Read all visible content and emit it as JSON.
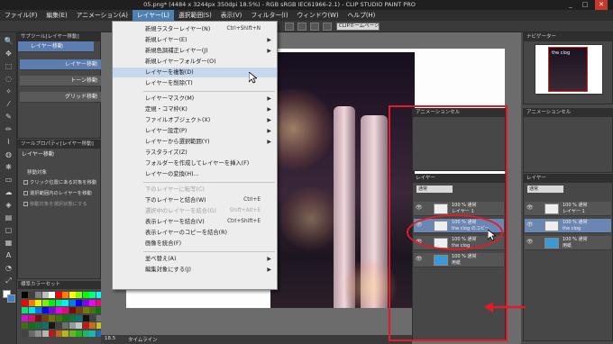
{
  "window": {
    "title": "05.png* (4484 x 3244px 350dpi 18.5%) - RGB sRGB IEC61966-2.1) - CLIP STUDIO PAINT PRO",
    "minimize": "_",
    "maximize": "□",
    "close": "✕"
  },
  "menubar": [
    {
      "label": "ファイル(F)"
    },
    {
      "label": "編集(E)"
    },
    {
      "label": "アニメーション(A)"
    },
    {
      "label": "レイヤー(L)",
      "active": true
    },
    {
      "label": "選択範囲(S)"
    },
    {
      "label": "表示(V)"
    },
    {
      "label": "フィルター(I)"
    },
    {
      "label": "ウィンドウ(W)"
    },
    {
      "label": "ヘルプ(H)"
    }
  ],
  "toolbar": {
    "homepage_button": "CLIPホームページ"
  },
  "left_panel": {
    "subtool_tab": "サブツール[レイヤー移動]",
    "subtool_group": "レイヤー移動",
    "subtools": [
      "レイヤー移動",
      "トーン移動",
      "グリッド移動"
    ],
    "property_tab": "ツールプロパティ[レイヤー移動]",
    "property_title": "レイヤー移動",
    "property_section": "移動対象",
    "options": [
      "クリック位置にある対象を移動",
      "選択範囲内のレイヤーを移動",
      "移動対象を選択状態にする"
    ],
    "palette_tab": "標準カラーセット"
  },
  "layer_menu": {
    "items": [
      {
        "label": "新規ラスターレイヤー(N)",
        "shortcut": "Ctrl+Shift+N"
      },
      {
        "label": "新規レイヤー(E)",
        "submenu": true
      },
      {
        "label": "新規色調補正レイヤー(J)",
        "submenu": true
      },
      {
        "label": "新規レイヤーフォルダー(O)"
      },
      {
        "label": "レイヤーを複製(D)",
        "highlighted": true
      },
      {
        "label": "レイヤーを削除(T)"
      },
      {
        "separator": true
      },
      {
        "label": "レイヤーマスク(M)",
        "submenu": true
      },
      {
        "label": "定規・コマ枠(K)",
        "submenu": true
      },
      {
        "label": "ファイルオブジェクト(X)",
        "submenu": true
      },
      {
        "label": "レイヤー設定(P)",
        "submenu": true
      },
      {
        "label": "レイヤーから選択範囲(Y)",
        "submenu": true
      },
      {
        "label": "ラスタライズ(Z)"
      },
      {
        "label": "フォルダーを作成してレイヤーを挿入(F)"
      },
      {
        "label": "レイヤーの変換(H)..."
      },
      {
        "separator": true
      },
      {
        "label": "下のレイヤーに転写(C)",
        "disabled": true
      },
      {
        "label": "下のレイヤーと結合(W)",
        "shortcut": "Ctrl+E"
      },
      {
        "label": "選択中のレイヤーを結合(G)",
        "shortcut": "Shift+Alt+E",
        "disabled": true
      },
      {
        "label": "表示レイヤーを結合(V)",
        "shortcut": "Ctrl+Shift+E"
      },
      {
        "label": "表示レイヤーのコピーを結合(R)"
      },
      {
        "label": "画像を統合(F)"
      },
      {
        "separator": true
      },
      {
        "label": "並べ替え(A)",
        "submenu": true
      },
      {
        "label": "編集対象にする(J)",
        "submenu": true
      }
    ]
  },
  "navigator": {
    "tab": "ナビゲーター",
    "thumb_caption": "the clog"
  },
  "animation_panel": {
    "tab": "アニメーションセル"
  },
  "layer_panels": [
    {
      "tab": "レイヤー",
      "blend": "通常",
      "layers": [
        {
          "line1": "100 % 通常",
          "line2": "レイヤー 1"
        },
        {
          "line1": "100 % 通常",
          "line2": "the clog のコピー",
          "selected": true
        },
        {
          "line1": "100 % 通常",
          "line2": "the clog"
        },
        {
          "line1": "100 % 通常",
          "line2": "用紙"
        }
      ]
    },
    {
      "tab": "レイヤー",
      "blend": "通常",
      "layers": [
        {
          "line1": "100 % 通常",
          "line2": "レイヤー 1"
        },
        {
          "line1": "100 % 通常",
          "line2": "the clog",
          "selected": true
        },
        {
          "line1": "100 % 通常",
          "line2": "用紙"
        }
      ]
    }
  ],
  "status": {
    "zoom": "18.5",
    "timeline_tab": "タイムライン"
  }
}
